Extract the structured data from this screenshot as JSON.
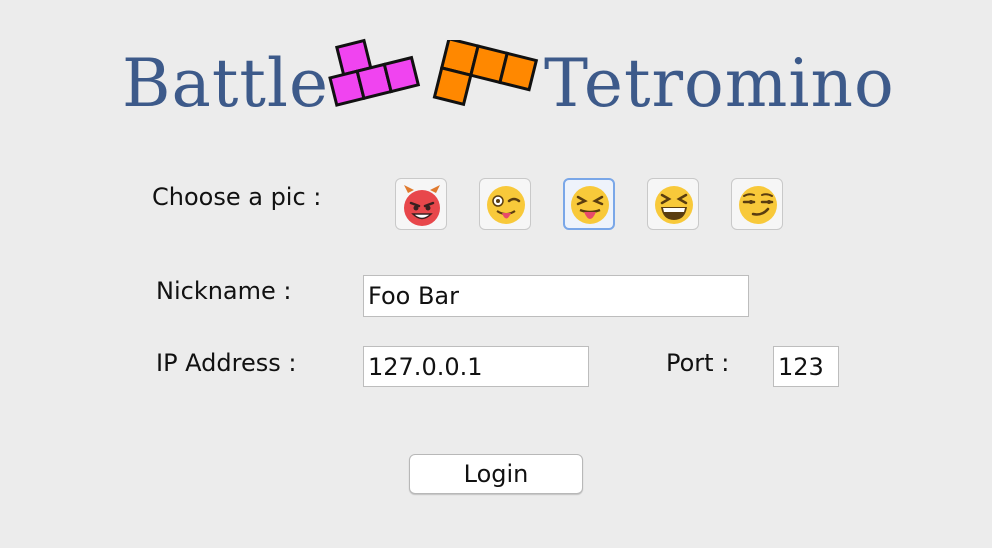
{
  "header": {
    "title_left": "Battle",
    "title_right": "Tetromino",
    "title_color": "#3d5a8a",
    "tetromino_colors": {
      "t_piece": "#f044f0",
      "l_piece": "#ff8800",
      "outline": "#111111"
    }
  },
  "form": {
    "pic_label": "Choose a pic :",
    "pics": [
      {
        "icon": "devil-face-icon",
        "selected": false
      },
      {
        "icon": "winking-tongue-face-icon",
        "selected": false
      },
      {
        "icon": "squinting-tongue-face-icon",
        "selected": true
      },
      {
        "icon": "grinning-squinting-face-icon",
        "selected": false
      },
      {
        "icon": "smirking-face-icon",
        "selected": false
      }
    ],
    "nickname_label": "Nickname :",
    "nickname_value": "Foo Bar",
    "ip_label": "IP Address :",
    "ip_value": "127.0.0.1",
    "port_label": "Port :",
    "port_value": "123",
    "login_label": "Login"
  }
}
